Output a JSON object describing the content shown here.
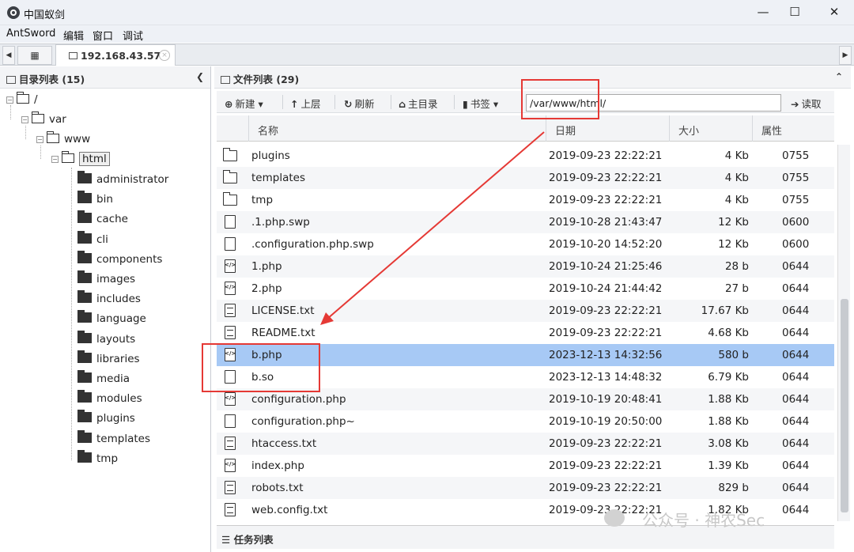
{
  "window": {
    "title": "中国蚁剑",
    "minimize": "—",
    "maximize": "☐",
    "close": "✕"
  },
  "menu": [
    "AntSword",
    "编辑",
    "窗口",
    "调试"
  ],
  "tabs": {
    "home_icon": "grid-icon",
    "connection": "192.168.43.57",
    "close": "×",
    "left_arrow": "◀",
    "right_arrow": "▶"
  },
  "dir_panel": {
    "title": "目录列表 (15)",
    "collapse": "❮",
    "root": "/",
    "var": "var",
    "www": "www",
    "html": "html",
    "children": [
      "administrator",
      "bin",
      "cache",
      "cli",
      "components",
      "images",
      "includes",
      "language",
      "layouts",
      "libraries",
      "media",
      "modules",
      "plugins",
      "templates",
      "tmp"
    ]
  },
  "file_panel": {
    "title": "文件列表 (29)",
    "collapse": "⌃",
    "toolbar": {
      "new": "新建",
      "up": "上层",
      "refresh": "刷新",
      "home": "主目录",
      "bookmark": "书签",
      "read": "读取"
    },
    "path": "/var/www/html/",
    "columns": [
      "名称",
      "日期",
      "大小",
      "属性"
    ],
    "files": [
      {
        "name": "plugins",
        "date": "2019-09-23 22:22:21",
        "size": "4 Kb",
        "perm": "0755",
        "icon": "folder"
      },
      {
        "name": "templates",
        "date": "2019-09-23 22:22:21",
        "size": "4 Kb",
        "perm": "0755",
        "icon": "folder"
      },
      {
        "name": "tmp",
        "date": "2019-09-23 22:22:21",
        "size": "4 Kb",
        "perm": "0755",
        "icon": "folder"
      },
      {
        "name": ".1.php.swp",
        "date": "2019-10-28 21:43:47",
        "size": "12 Kb",
        "perm": "0600",
        "icon": "file"
      },
      {
        "name": ".configuration.php.swp",
        "date": "2019-10-20 14:52:20",
        "size": "12 Kb",
        "perm": "0600",
        "icon": "file"
      },
      {
        "name": "1.php",
        "date": "2019-10-24 21:25:46",
        "size": "28 b",
        "perm": "0644",
        "icon": "code"
      },
      {
        "name": "2.php",
        "date": "2019-10-24 21:44:42",
        "size": "27 b",
        "perm": "0644",
        "icon": "code"
      },
      {
        "name": "LICENSE.txt",
        "date": "2019-09-23 22:22:21",
        "size": "17.67 Kb",
        "perm": "0644",
        "icon": "text"
      },
      {
        "name": "README.txt",
        "date": "2019-09-23 22:22:21",
        "size": "4.68 Kb",
        "perm": "0644",
        "icon": "text"
      },
      {
        "name": "b.php",
        "date": "2023-12-13 14:32:56",
        "size": "580 b",
        "perm": "0644",
        "icon": "code",
        "selected": true
      },
      {
        "name": "b.so",
        "date": "2023-12-13 14:48:32",
        "size": "6.79 Kb",
        "perm": "0644",
        "icon": "file"
      },
      {
        "name": "configuration.php",
        "date": "2019-10-19 20:48:41",
        "size": "1.88 Kb",
        "perm": "0644",
        "icon": "code"
      },
      {
        "name": "configuration.php~",
        "date": "2019-10-19 20:50:00",
        "size": "1.88 Kb",
        "perm": "0644",
        "icon": "file"
      },
      {
        "name": "htaccess.txt",
        "date": "2019-09-23 22:22:21",
        "size": "3.08 Kb",
        "perm": "0644",
        "icon": "text"
      },
      {
        "name": "index.php",
        "date": "2019-09-23 22:22:21",
        "size": "1.39 Kb",
        "perm": "0644",
        "icon": "code"
      },
      {
        "name": "robots.txt",
        "date": "2019-09-23 22:22:21",
        "size": "829 b",
        "perm": "0644",
        "icon": "text"
      },
      {
        "name": "web.config.txt",
        "date": "2019-09-23 22:22:21",
        "size": "1.82 Kb",
        "perm": "0644",
        "icon": "text"
      }
    ]
  },
  "task_panel": {
    "title": "任务列表"
  },
  "watermark": "公众号 · 神农Sec",
  "colors": {
    "selected_row": "#a7c9f5",
    "annotation": "#e53935"
  }
}
